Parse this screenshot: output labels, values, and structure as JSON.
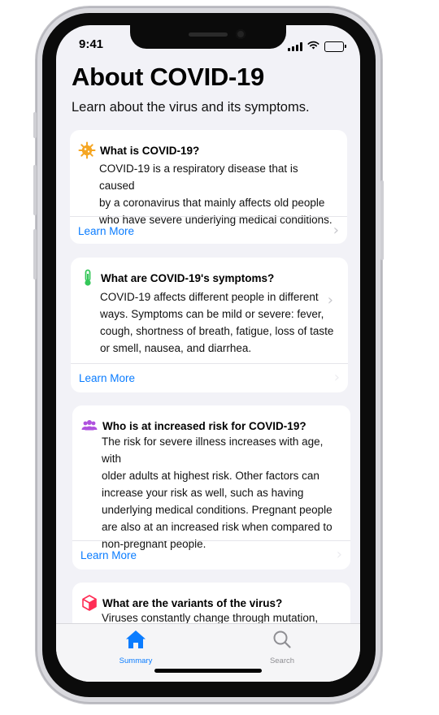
{
  "status_bar": {
    "time": "9:41"
  },
  "header": {
    "title": "About COVID-19",
    "subtitle": "Learn about the virus and its symptoms."
  },
  "cards": [
    {
      "icon": "virus-icon",
      "icon_color": "#f5a623",
      "title": "What is COVID-19?",
      "lines": [
        "COVID-19 is a respiratory disease that is caused",
        "by a coronavirus that mainly affects old people",
        "who have severe underlying medical conditions."
      ],
      "action": "Learn More"
    },
    {
      "icon": "thermometer-icon",
      "icon_color": "#34c759",
      "title": "What are COVID-19's symptoms?",
      "lines": [
        "COVID-19 affects different people in different",
        "ways. Symptoms can be mild or severe: fever,",
        "cough, shortness of breath, fatigue,  loss of taste",
        "or smell, nausea, and diarrhea."
      ],
      "action": "Learn More"
    },
    {
      "icon": "people-icon",
      "icon_color": "#af52de",
      "title": "Who is at increased risk for COVID-19?",
      "lines": [
        "The risk for severe illness increases with age, with",
        "older adults at highest risk. Other factors can",
        "increase your risk as well, such as having",
        "underlying medical conditions. Pregnant people",
        "are also at an increased risk when compared to",
        "non-pregnant people."
      ],
      "action": "Learn More"
    },
    {
      "icon": "cube-icon",
      "icon_color": "#ff2d55",
      "title": "What are the variants of the virus?",
      "lines": [
        "Viruses constantly change through mutation, and"
      ]
    }
  ],
  "tab_bar": {
    "items": [
      {
        "label": "Summary",
        "icon": "house-icon",
        "selected": true,
        "color": "#0a7cff"
      },
      {
        "label": "Search",
        "icon": "magnifier-icon",
        "selected": false,
        "color": "#8e8e93"
      }
    ]
  }
}
